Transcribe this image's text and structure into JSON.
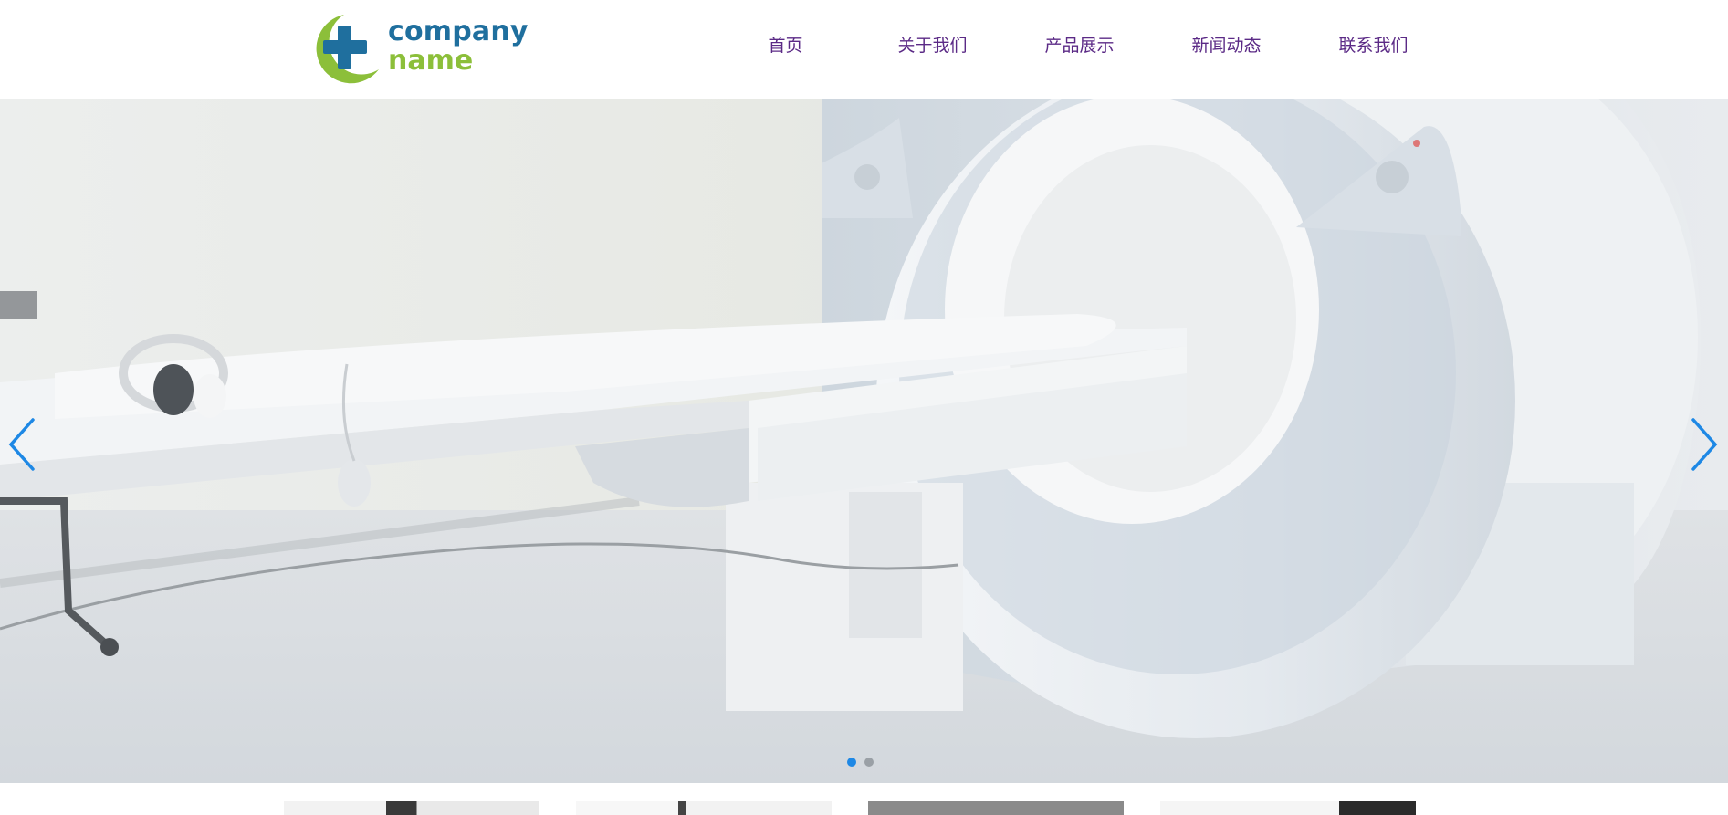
{
  "brand": {
    "line1": "company",
    "line2": "name",
    "primary_color": "#1f6f9e",
    "secondary_color": "#8cbf3a"
  },
  "nav": {
    "items": [
      {
        "label": "首页"
      },
      {
        "label": "关于我们"
      },
      {
        "label": "产品展示"
      },
      {
        "label": "新闻动态"
      },
      {
        "label": "联系我们"
      }
    ],
    "color": "#5b2a86"
  },
  "slider": {
    "prev_icon": "chevron-left-icon",
    "next_icon": "chevron-right-icon",
    "slide_count": 2,
    "active_index": 0,
    "accent_color": "#1e88e5"
  },
  "thumbnails": {
    "count": 4
  }
}
